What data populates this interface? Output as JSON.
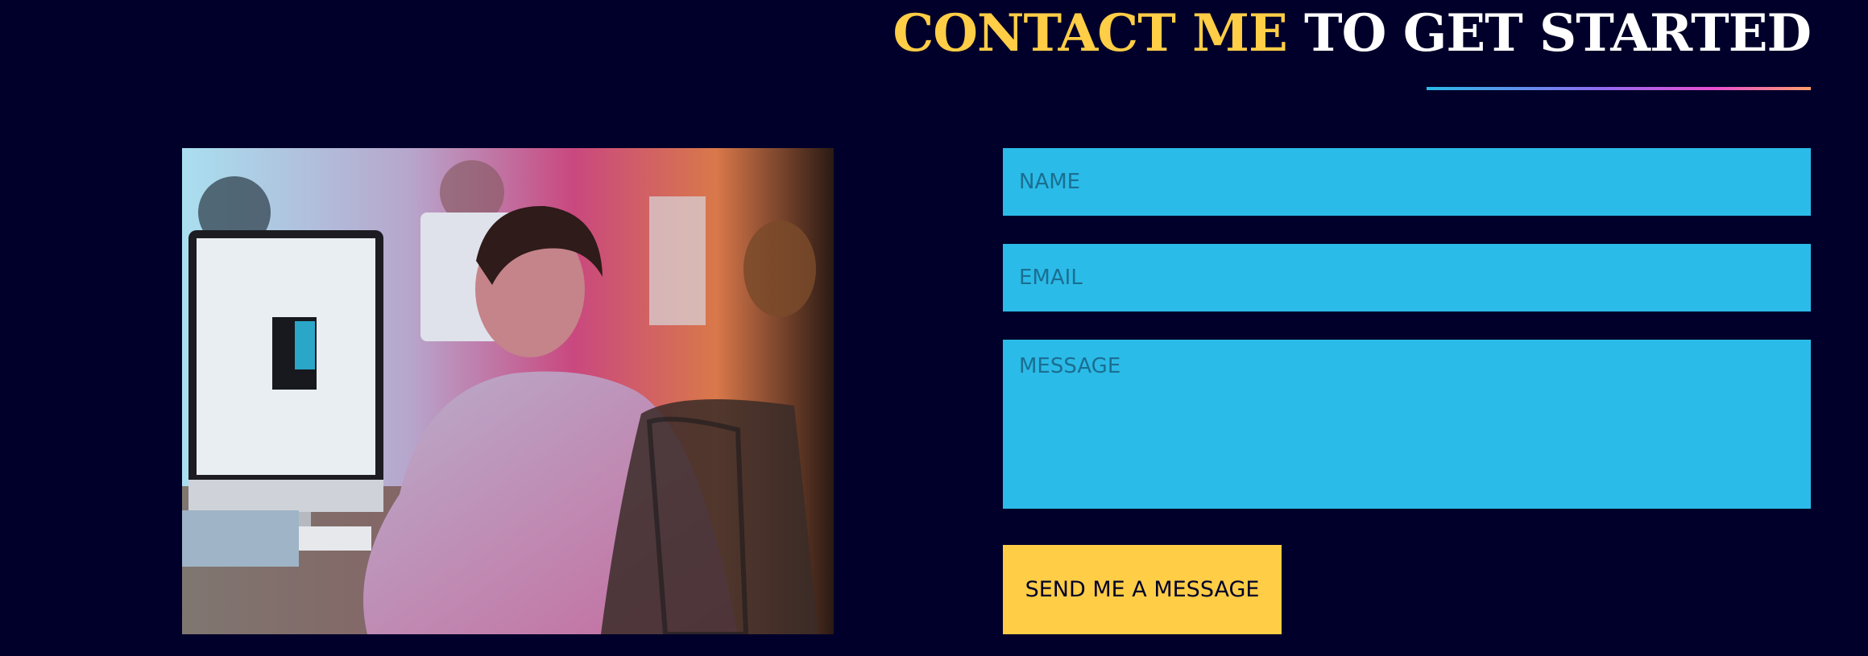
{
  "heading": {
    "accent": "CONTACT ME",
    "rest": "TO GET STARTED"
  },
  "photo": {
    "alt": "Man working at desktop computer in an office"
  },
  "form": {
    "name_placeholder": "NAME",
    "email_placeholder": "EMAIL",
    "message_placeholder": "MESSAGE",
    "submit_label": "SEND ME A MESSAGE"
  },
  "colors": {
    "background": "#00002a",
    "accent_yellow": "#ffcd46",
    "field_blue": "#2bbbe8",
    "field_text": "#1a6f92"
  }
}
